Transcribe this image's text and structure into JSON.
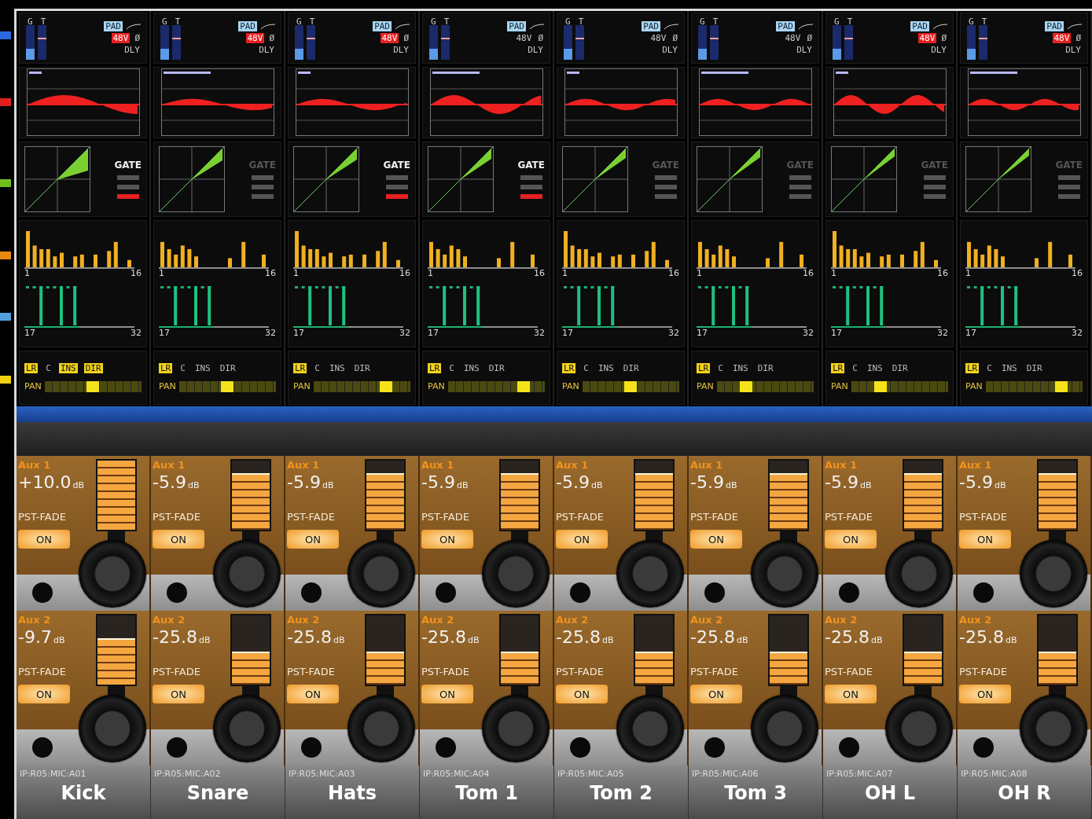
{
  "strips": [
    {
      "header": {
        "g": "G",
        "t": "T",
        "pad": "PAD",
        "phantom": {
          "label": "48V",
          "on": true
        },
        "phase": "Ø",
        "delay": "DLY"
      },
      "gate": {
        "label": "GATE",
        "active": true
      },
      "meter_labels": [
        "1",
        "16",
        "17",
        "32"
      ],
      "routing": [
        {
          "label": "LR",
          "on": true
        },
        {
          "label": "C",
          "on": false
        },
        {
          "label": "INS",
          "on": true
        },
        {
          "label": "DIR",
          "on": true
        }
      ],
      "pan": {
        "label": "PAN",
        "level": 0.5
      },
      "sends": [
        {
          "label": "Aux 1",
          "value": "+10.0",
          "unit": "dB",
          "mode": "PST-FADE",
          "button": "ON",
          "level": 1.0
        },
        {
          "label": "Aux 2",
          "value": "-9.7",
          "unit": "dB",
          "mode": "PST-FADE",
          "button": "ON",
          "level": 0.65
        }
      ],
      "source": "IP:R05:MIC:A01",
      "name": "Kick"
    },
    {
      "header": {
        "g": "G",
        "t": "T",
        "pad": "PAD",
        "phantom": {
          "label": "48V",
          "on": true
        },
        "phase": "Ø",
        "delay": "DLY"
      },
      "gate": {
        "label": "GATE",
        "active": false
      },
      "meter_labels": [
        "1",
        "16",
        "17",
        "32"
      ],
      "routing": [
        {
          "label": "LR",
          "on": true
        },
        {
          "label": "C",
          "on": false
        },
        {
          "label": "INS",
          "on": false
        },
        {
          "label": "DIR",
          "on": false
        }
      ],
      "pan": {
        "label": "PAN",
        "level": 0.5
      },
      "sends": [
        {
          "label": "Aux 1",
          "value": "-5.9",
          "unit": "dB",
          "mode": "PST-FADE",
          "button": "ON",
          "level": 0.8
        },
        {
          "label": "Aux 2",
          "value": "-25.8",
          "unit": "dB",
          "mode": "PST-FADE",
          "button": "ON",
          "level": 0.45
        }
      ],
      "source": "IP:R05:MIC:A02",
      "name": "Snare"
    },
    {
      "header": {
        "g": "G",
        "t": "T",
        "pad": "PAD",
        "phantom": {
          "label": "48V",
          "on": true
        },
        "phase": "Ø",
        "delay": "DLY"
      },
      "gate": {
        "label": "GATE",
        "active": true
      },
      "meter_labels": [
        "1",
        "16",
        "17",
        "32"
      ],
      "routing": [
        {
          "label": "LR",
          "on": true
        },
        {
          "label": "C",
          "on": false
        },
        {
          "label": "INS",
          "on": false
        },
        {
          "label": "DIR",
          "on": false
        }
      ],
      "pan": {
        "label": "PAN",
        "level": 0.75
      },
      "sends": [
        {
          "label": "Aux 1",
          "value": "-5.9",
          "unit": "dB",
          "mode": "PST-FADE",
          "button": "ON",
          "level": 0.8
        },
        {
          "label": "Aux 2",
          "value": "-25.8",
          "unit": "dB",
          "mode": "PST-FADE",
          "button": "ON",
          "level": 0.45
        }
      ],
      "source": "IP:R05:MIC:A03",
      "name": "Hats"
    },
    {
      "header": {
        "g": "G",
        "t": "T",
        "pad": "PAD",
        "phantom": {
          "label": "48V",
          "on": false
        },
        "phase": "Ø",
        "delay": "DLY"
      },
      "gate": {
        "label": "GATE",
        "active": true
      },
      "meter_labels": [
        "1",
        "16",
        "17",
        "32"
      ],
      "routing": [
        {
          "label": "LR",
          "on": true
        },
        {
          "label": "C",
          "on": false
        },
        {
          "label": "INS",
          "on": false
        },
        {
          "label": "DIR",
          "on": false
        }
      ],
      "pan": {
        "label": "PAN",
        "level": 0.78
      },
      "sends": [
        {
          "label": "Aux 1",
          "value": "-5.9",
          "unit": "dB",
          "mode": "PST-FADE",
          "button": "ON",
          "level": 0.8
        },
        {
          "label": "Aux 2",
          "value": "-25.8",
          "unit": "dB",
          "mode": "PST-FADE",
          "button": "ON",
          "level": 0.45
        }
      ],
      "source": "IP:R05:MIC:A04",
      "name": "Tom 1"
    },
    {
      "header": {
        "g": "G",
        "t": "T",
        "pad": "PAD",
        "phantom": {
          "label": "48V",
          "on": false
        },
        "phase": "Ø",
        "delay": "DLY"
      },
      "gate": {
        "label": "GATE",
        "active": false
      },
      "meter_labels": [
        "1",
        "16",
        "17",
        "32"
      ],
      "routing": [
        {
          "label": "LR",
          "on": true
        },
        {
          "label": "C",
          "on": false
        },
        {
          "label": "INS",
          "on": false
        },
        {
          "label": "DIR",
          "on": false
        }
      ],
      "pan": {
        "label": "PAN",
        "level": 0.5
      },
      "sends": [
        {
          "label": "Aux 1",
          "value": "-5.9",
          "unit": "dB",
          "mode": "PST-FADE",
          "button": "ON",
          "level": 0.8
        },
        {
          "label": "Aux 2",
          "value": "-25.8",
          "unit": "dB",
          "mode": "PST-FADE",
          "button": "ON",
          "level": 0.45
        }
      ],
      "source": "IP:R05:MIC:A05",
      "name": "Tom 2"
    },
    {
      "header": {
        "g": "G",
        "t": "T",
        "pad": "PAD",
        "phantom": {
          "label": "48V",
          "on": false
        },
        "phase": "Ø",
        "delay": "DLY"
      },
      "gate": {
        "label": "GATE",
        "active": false
      },
      "meter_labels": [
        "1",
        "16",
        "17",
        "32"
      ],
      "routing": [
        {
          "label": "LR",
          "on": true
        },
        {
          "label": "C",
          "on": false
        },
        {
          "label": "INS",
          "on": false
        },
        {
          "label": "DIR",
          "on": false
        }
      ],
      "pan": {
        "label": "PAN",
        "level": 0.3
      },
      "sends": [
        {
          "label": "Aux 1",
          "value": "-5.9",
          "unit": "dB",
          "mode": "PST-FADE",
          "button": "ON",
          "level": 0.8
        },
        {
          "label": "Aux 2",
          "value": "-25.8",
          "unit": "dB",
          "mode": "PST-FADE",
          "button": "ON",
          "level": 0.45
        }
      ],
      "source": "IP:R05:MIC:A06",
      "name": "Tom 3"
    },
    {
      "header": {
        "g": "G",
        "t": "T",
        "pad": "PAD",
        "phantom": {
          "label": "48V",
          "on": true
        },
        "phase": "Ø",
        "delay": "DLY"
      },
      "gate": {
        "label": "GATE",
        "active": false
      },
      "meter_labels": [
        "1",
        "16",
        "17",
        "32"
      ],
      "routing": [
        {
          "label": "LR",
          "on": true
        },
        {
          "label": "C",
          "on": false
        },
        {
          "label": "INS",
          "on": false
        },
        {
          "label": "DIR",
          "on": false
        }
      ],
      "pan": {
        "label": "PAN",
        "level": 0.3
      },
      "sends": [
        {
          "label": "Aux 1",
          "value": "-5.9",
          "unit": "dB",
          "mode": "PST-FADE",
          "button": "ON",
          "level": 0.8
        },
        {
          "label": "Aux 2",
          "value": "-25.8",
          "unit": "dB",
          "mode": "PST-FADE",
          "button": "ON",
          "level": 0.45
        }
      ],
      "source": "IP:R05:MIC:A07",
      "name": "OH L"
    },
    {
      "header": {
        "g": "G",
        "t": "T",
        "pad": "PAD",
        "phantom": {
          "label": "48V",
          "on": true
        },
        "phase": "Ø",
        "delay": "DLY"
      },
      "gate": {
        "label": "GATE",
        "active": false
      },
      "meter_labels": [
        "1",
        "16",
        "17",
        "32"
      ],
      "routing": [
        {
          "label": "LR",
          "on": true
        },
        {
          "label": "C",
          "on": false
        },
        {
          "label": "INS",
          "on": false
        },
        {
          "label": "DIR",
          "on": false
        }
      ],
      "pan": {
        "label": "PAN",
        "level": 0.78
      },
      "sends": [
        {
          "label": "Aux 1",
          "value": "-5.9",
          "unit": "dB",
          "mode": "PST-FADE",
          "button": "ON",
          "level": 0.8
        },
        {
          "label": "Aux 2",
          "value": "-25.8",
          "unit": "dB",
          "mode": "PST-FADE",
          "button": "ON",
          "level": 0.45
        }
      ],
      "source": "IP:R05:MIC:A08",
      "name": "OH R"
    }
  ]
}
